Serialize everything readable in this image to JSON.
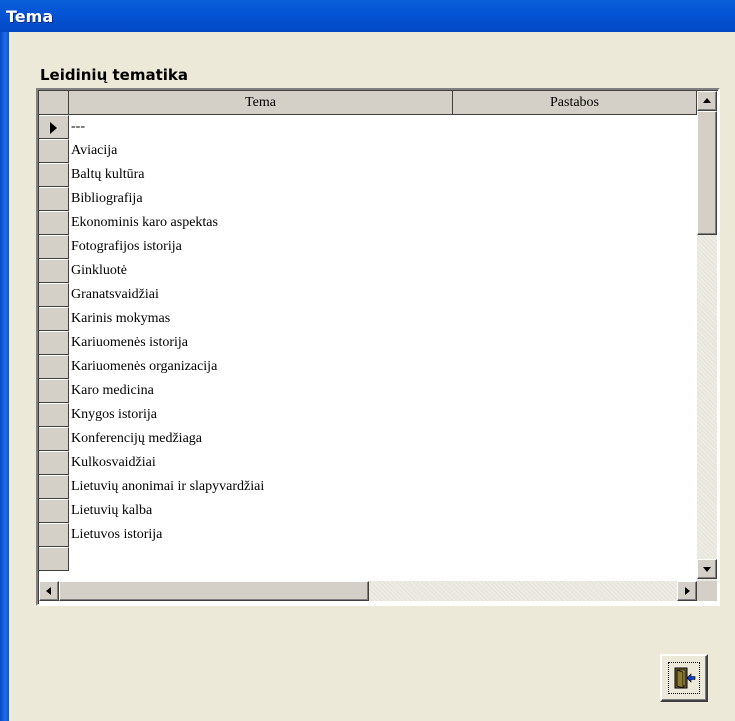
{
  "window": {
    "title": "Tema"
  },
  "section": {
    "label": "Leidinių tematika"
  },
  "grid": {
    "columns": [
      "Tema",
      "Pastabos"
    ],
    "rows": [
      {
        "tema": "---",
        "pastabos": ""
      },
      {
        "tema": "Aviacija",
        "pastabos": ""
      },
      {
        "tema": "Baltų kultūra",
        "pastabos": ""
      },
      {
        "tema": "Bibliografija",
        "pastabos": ""
      },
      {
        "tema": "Ekonominis karo aspektas",
        "pastabos": ""
      },
      {
        "tema": "Fotografijos istorija",
        "pastabos": ""
      },
      {
        "tema": "Ginkluotė",
        "pastabos": ""
      },
      {
        "tema": "Granatsvaidžiai",
        "pastabos": ""
      },
      {
        "tema": "Karinis mokymas",
        "pastabos": ""
      },
      {
        "tema": "Kariuomenės istorija",
        "pastabos": ""
      },
      {
        "tema": "Kariuomenės organizacija",
        "pastabos": ""
      },
      {
        "tema": "Karo medicina",
        "pastabos": ""
      },
      {
        "tema": "Knygos istorija",
        "pastabos": ""
      },
      {
        "tema": "Konferencijų medžiaga",
        "pastabos": ""
      },
      {
        "tema": "Kulkosvaidžiai",
        "pastabos": ""
      },
      {
        "tema": "Lietuvių anonimai ir slapyvardžiai",
        "pastabos": ""
      },
      {
        "tema": "Lietuvių kalba",
        "pastabos": ""
      },
      {
        "tema": "Lietuvos istorija",
        "pastabos": ""
      },
      {
        "tema": "",
        "pastabos": ""
      }
    ],
    "current_row_index": 0
  },
  "buttons": {
    "exit_icon": "exit-door-icon"
  },
  "colors": {
    "titlebar": "#0454d6",
    "window_bg": "#ece9d8",
    "grid_bg": "#ffffff",
    "header_bg": "#d4d0c8"
  }
}
